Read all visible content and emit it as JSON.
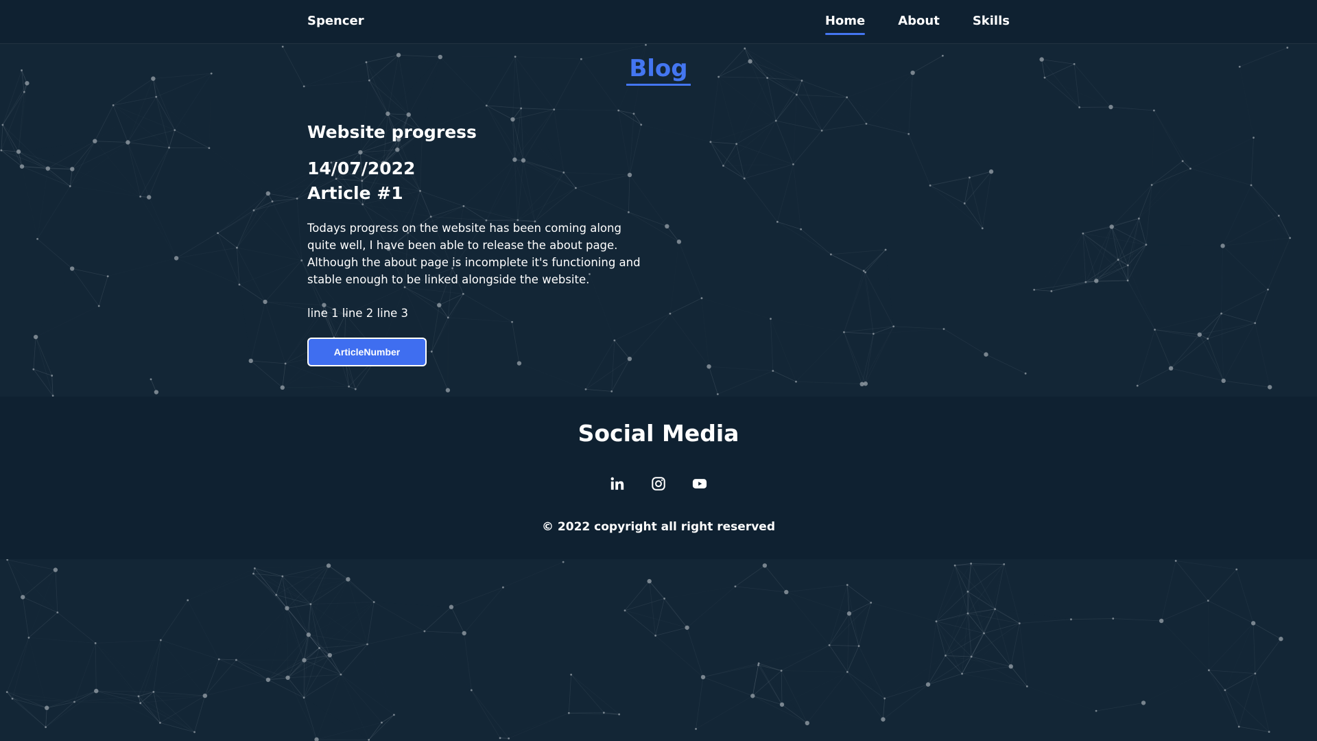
{
  "navbar": {
    "brand": "Spencer",
    "links": [
      {
        "label": "Home",
        "active": true
      },
      {
        "label": "About",
        "active": false
      },
      {
        "label": "Skills",
        "active": false
      }
    ]
  },
  "blog": {
    "title": "Blog",
    "article": {
      "heading": "Website progress",
      "date": "14/07/2022",
      "number": "Article #1",
      "body": "Todays progress on the website has been coming along quite well, I have been able to release the about page. Although the about page is incomplete it's functioning and stable enough to be linked alongside the website.",
      "lines": "line 1 line 2 line 3",
      "button_label": "ArticleNumber"
    }
  },
  "social": {
    "title": "Social Media",
    "icons": [
      "linkedin-icon",
      "instagram-icon",
      "youtube-icon"
    ],
    "copyright": "© 2022 copyright all right reserved"
  },
  "colors": {
    "background": "#0f2131",
    "accent": "#4476f1",
    "text": "#ffffff"
  }
}
